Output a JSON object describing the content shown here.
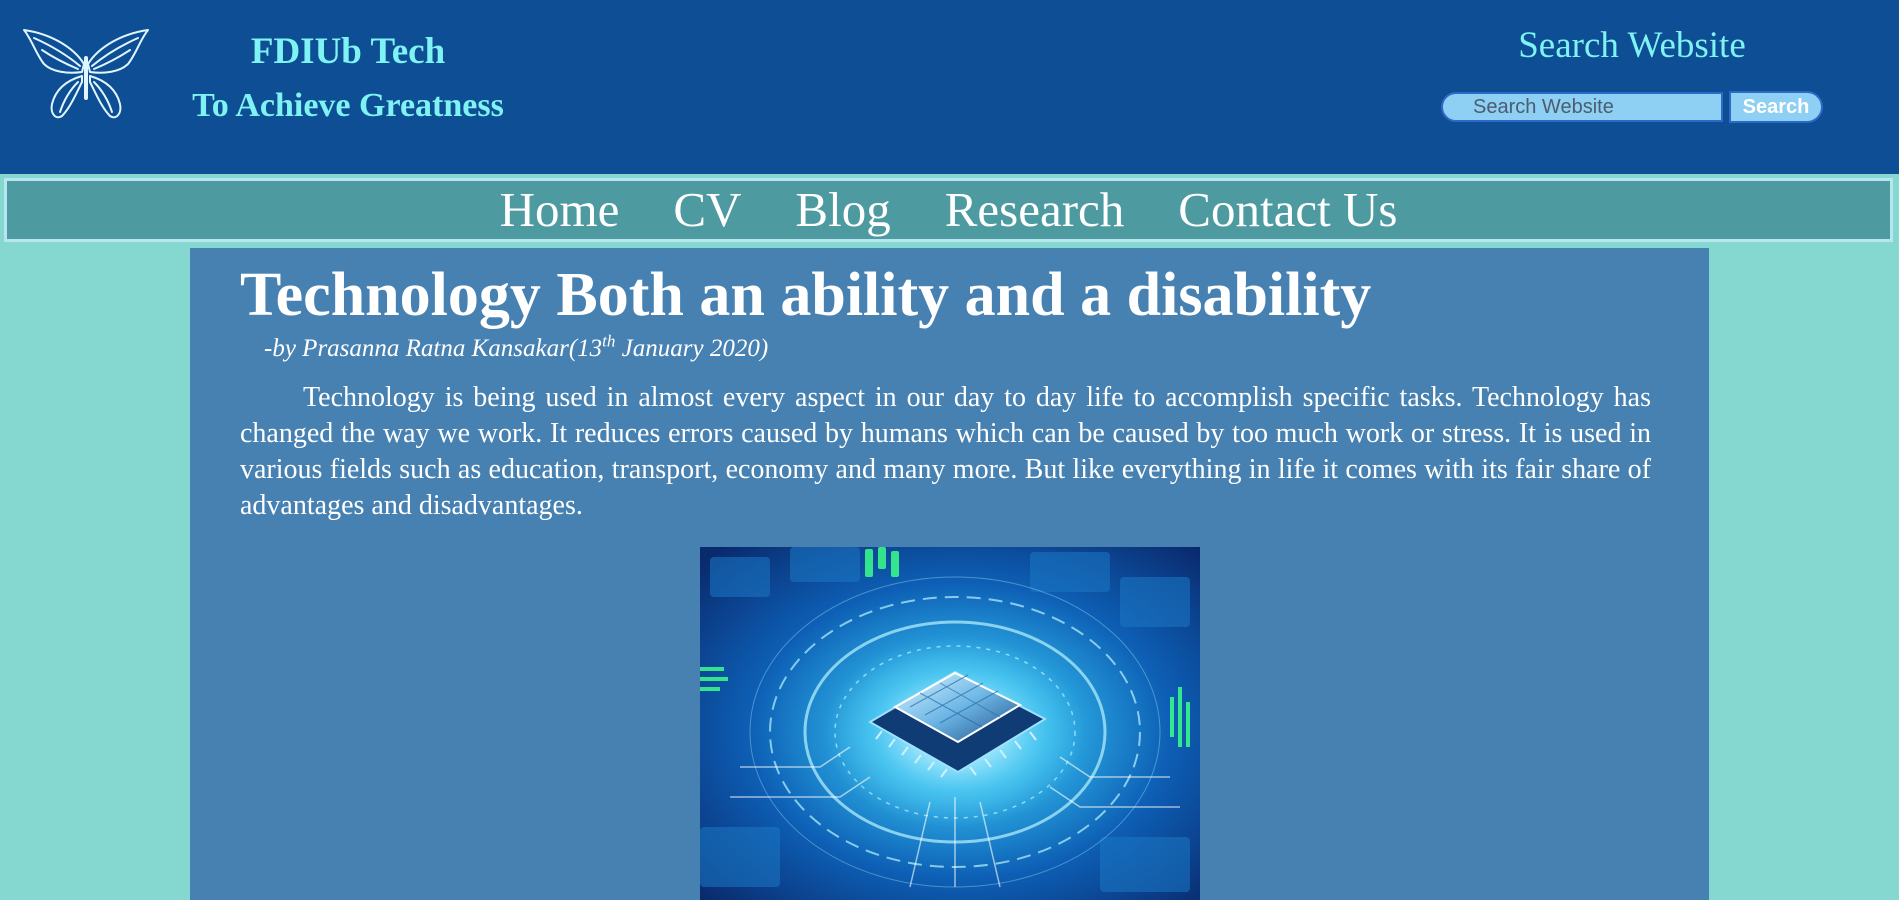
{
  "header": {
    "site_title": "FDIUb Tech",
    "tagline": "To Achieve Greatness",
    "logo_icon": "butterfly-icon",
    "search": {
      "heading": "Search Website",
      "placeholder": "Search Website",
      "value": "",
      "button_label": "Search"
    }
  },
  "nav": {
    "items": [
      {
        "label": "Home"
      },
      {
        "label": "CV"
      },
      {
        "label": "Blog"
      },
      {
        "label": "Research"
      },
      {
        "label": "Contact Us"
      }
    ]
  },
  "article": {
    "title": "Technology Both an ability and a disability",
    "byline_prefix": "-by Prasanna Ratna Kansakar(13",
    "byline_sup": "th",
    "byline_suffix": " January 2020)",
    "body": "Technology is being used in almost every aspect in our day to day life to accomplish specific tasks. Technology has changed the way we work. It reduces errors caused by humans which can be caused by too much work or stress. It is used in various fields such as education, transport, economy and many more. But like everything in life it comes with its fair share of advantages and disadvantages.",
    "image_icon": "microchip-image"
  },
  "colors": {
    "header_bg": "#0e4e94",
    "accent_text": "#7ff3f3",
    "nav_bg": "#4d9aa0",
    "content_bg": "#4781b2",
    "page_bg": "#85d8cf"
  }
}
